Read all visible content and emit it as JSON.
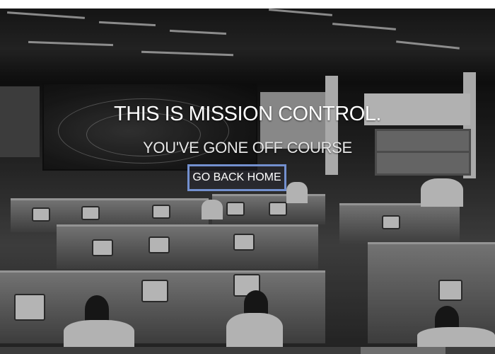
{
  "hero": {
    "title": "THIS IS MISSION CONTROL.",
    "subtitle": "YOU'VE GONE OFF COURSE",
    "button_label": "GO BACK HOME"
  },
  "colors": {
    "button_border": "#7390cf",
    "text": "#ffffff"
  }
}
